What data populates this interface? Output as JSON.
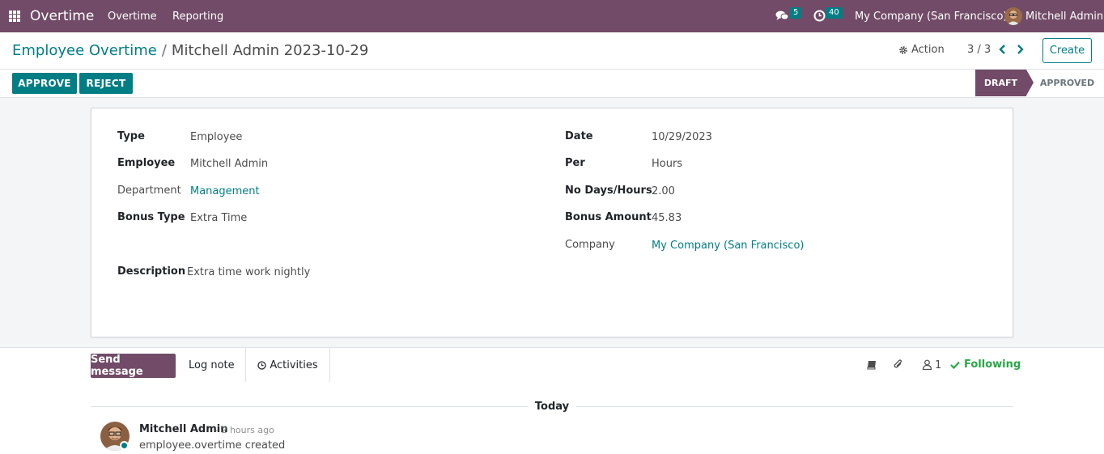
{
  "navbar": {
    "brand": "Overtime",
    "menu": [
      "Overtime",
      "Reporting"
    ],
    "messages_count": "5",
    "activities_count": "40",
    "company": "My Company (San Francisco)",
    "user": "Mitchell Admin",
    "background": "#714b67"
  },
  "control": {
    "breadcrumb_root": "Employee Overtime",
    "breadcrumb_separator": "/",
    "breadcrumb_current": "Mitchell Admin 2023-10-29",
    "action_label": "Action",
    "pager": "3 / 3",
    "create_label": "Create"
  },
  "statusbar": {
    "approve_label": "APPROVE",
    "reject_label": "REJECT",
    "stages": [
      "DRAFT",
      "APPROVED"
    ],
    "active_stage": "DRAFT"
  },
  "form": {
    "type_label": "Type",
    "type_value": "Employee",
    "employee_label": "Employee",
    "employee_value": "Mitchell Admin",
    "department_label": "Department",
    "department_value": "Management",
    "bonus_type_label": "Bonus Type",
    "bonus_type_value": "Extra Time",
    "description_label": "Description",
    "description_value": "Extra time work nightly",
    "date_label": "Date",
    "date_value": "10/29/2023",
    "per_label": "Per",
    "per_value": "Hours",
    "no_days_label": "No Days/Hours",
    "no_days_value": "2.00",
    "bonus_amount_label": "Bonus Amount",
    "bonus_amount_value": "45.83",
    "company_label": "Company",
    "company_value": "My Company (San Francisco)"
  },
  "chatter": {
    "send_message_label": "Send message",
    "log_note_label": "Log note",
    "activities_label": "Activities",
    "followers_count": "1",
    "following_label": "Following",
    "today_label": "Today",
    "messages": [
      {
        "author": "Mitchell Admin",
        "date": "- 2 hours ago",
        "body": "employee.overtime created"
      }
    ]
  },
  "colors": {
    "primary": "#714b67",
    "accent": "#017e84",
    "following": "#28a745"
  }
}
